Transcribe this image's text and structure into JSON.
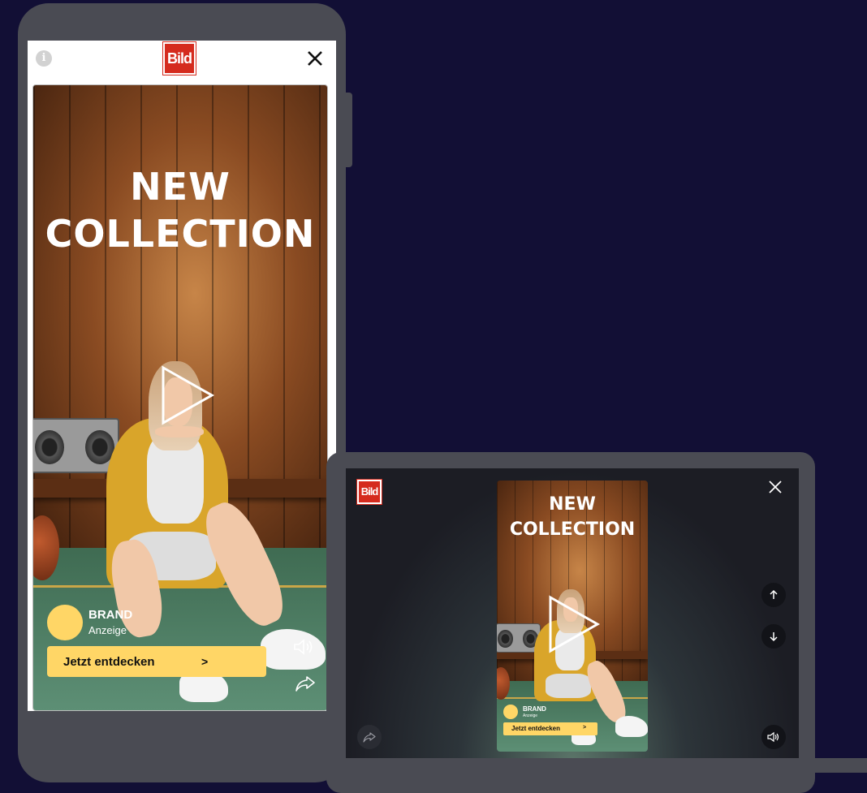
{
  "brand_logo": "Bild",
  "ad": {
    "headline_line1": "NEW",
    "headline_line2": "COLLECTION",
    "brand_name": "BRAND",
    "brand_label": "Anzeige",
    "cta_label": "Jetzt entdecken",
    "cta_arrow": ">"
  },
  "icons": {
    "info": "i",
    "close": "close-icon",
    "play": "play-icon",
    "sound": "speaker-icon",
    "share": "share-icon",
    "up": "arrow-up-icon",
    "down": "arrow-down-icon"
  },
  "colors": {
    "background": "#120f35",
    "device": "#4a4b53",
    "accent": "#ffd666",
    "logo": "#d52b1e"
  }
}
